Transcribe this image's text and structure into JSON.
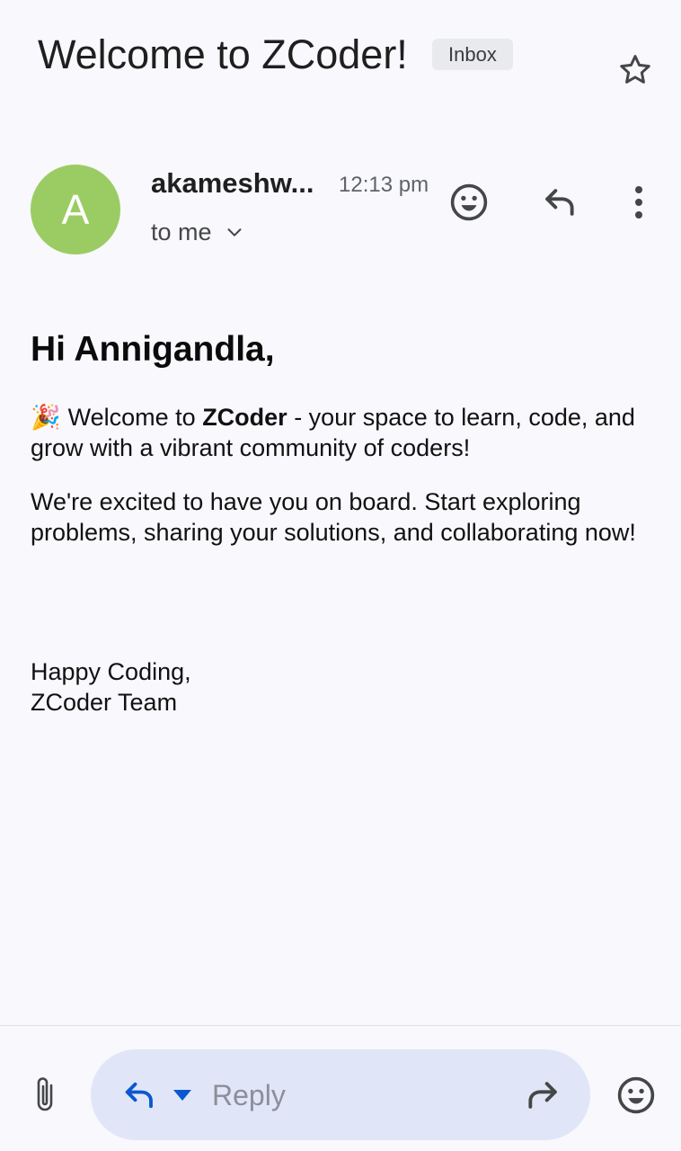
{
  "header": {
    "subject": "Welcome to ZCoder!",
    "label": "Inbox",
    "star_icon": "star-outline-icon"
  },
  "message": {
    "avatar_letter": "A",
    "avatar_color": "#9bcc63",
    "sender": "akameshw...",
    "time": "12:13 pm",
    "recipient": "to me",
    "actions": [
      "emoji-icon",
      "reply-icon",
      "more-vert-icon"
    ]
  },
  "body": {
    "greeting": "Hi Annigandla,",
    "p1_emoji": "🎉",
    "p1_prefix": "Welcome to ",
    "p1_bold": "ZCoder",
    "p1_suffix": " - your space to learn, code, and grow with a vibrant community of coders!",
    "p2": "We're excited to have you on board. Start exploring problems, sharing your solutions, and collaborating now!",
    "sign_line1": "Happy Coding,",
    "sign_line2": "ZCoder Team"
  },
  "bottom_bar": {
    "reply_placeholder": "Reply",
    "accent_color": "#0b57d0",
    "icons": [
      "attach-icon",
      "reply-icon",
      "dropdown-icon",
      "forward-icon",
      "emoji-icon"
    ]
  }
}
